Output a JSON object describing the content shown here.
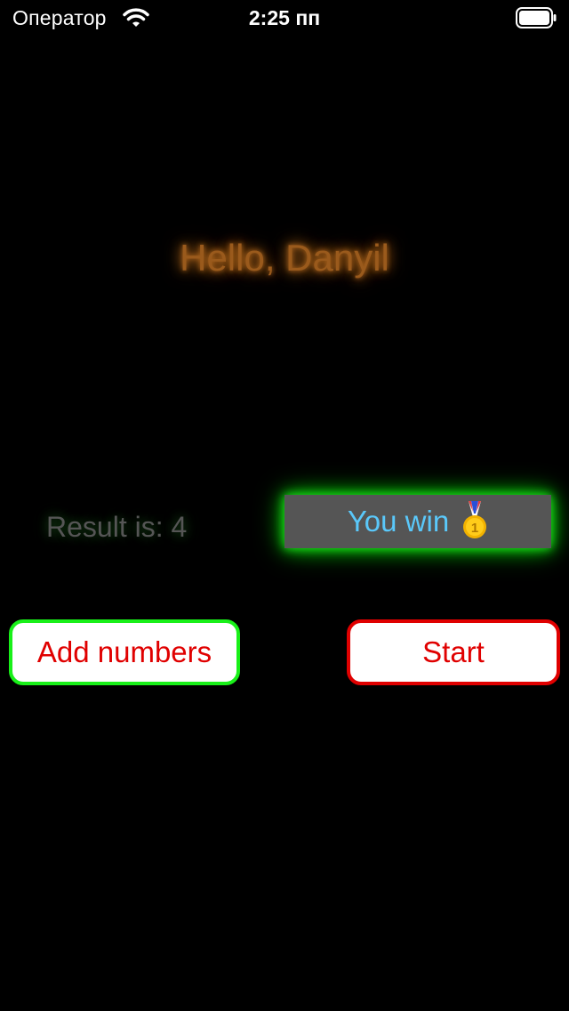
{
  "status_bar": {
    "carrier": "Оператор",
    "time": "2:25 пп",
    "wifi_icon": "wifi-icon",
    "battery_icon": "battery-full-icon"
  },
  "greeting": {
    "text": "Hello, Danyil",
    "color": "#9a5a1c",
    "glow": "#c77420"
  },
  "result": {
    "text": "Result is: 4"
  },
  "win_panel": {
    "label": "You win",
    "icon": "gold-medal-icon",
    "background": "#555555",
    "glow": "#19e619",
    "text_color": "#5ac8fa"
  },
  "buttons": {
    "add_numbers": {
      "label": "Add numbers",
      "border_color": "#19f019",
      "text_color": "#e00000"
    },
    "start": {
      "label": "Start",
      "border_color": "#e00000",
      "text_color": "#e00000"
    }
  }
}
